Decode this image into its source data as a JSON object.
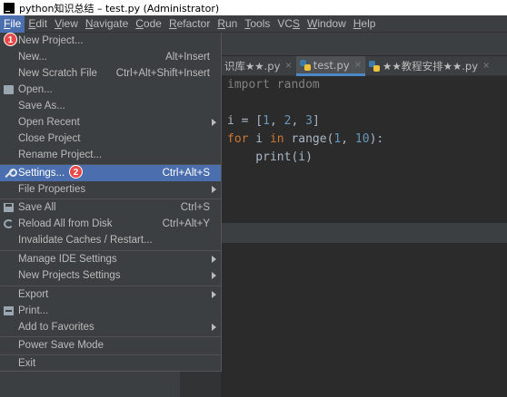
{
  "window": {
    "title": "python知识总结 – test.py (Administrator)"
  },
  "menubar": [
    {
      "label": "File",
      "mnemonic": "F",
      "rest": "ile"
    },
    {
      "label": "Edit",
      "mnemonic": "E",
      "rest": "dit"
    },
    {
      "label": "View",
      "mnemonic": "V",
      "rest": "iew"
    },
    {
      "label": "Navigate",
      "mnemonic": "N",
      "rest": "avigate"
    },
    {
      "label": "Code",
      "mnemonic": "C",
      "rest": "ode"
    },
    {
      "label": "Refactor",
      "mnemonic": "R",
      "rest": "efactor"
    },
    {
      "label": "Run",
      "mnemonic": "R",
      "rest": "un"
    },
    {
      "label": "Tools",
      "mnemonic": "T",
      "rest": "ools"
    },
    {
      "label": "VCS",
      "mnemonic": "S",
      "rest": "VC"
    },
    {
      "label": "Window",
      "mnemonic": "W",
      "rest": "indow"
    },
    {
      "label": "Help",
      "mnemonic": "H",
      "rest": "elp"
    }
  ],
  "tabs": [
    {
      "label": "识库★★.py",
      "close": "×"
    },
    {
      "label": "test.py",
      "close": "×"
    },
    {
      "label": "★★教程安排★★.py",
      "close": "×"
    }
  ],
  "editor": {
    "line1": "import random",
    "line2_a": "i = [",
    "line2_n1": "1",
    "line2_c1": ", ",
    "line2_n2": "2",
    "line2_c2": ", ",
    "line2_n3": "3",
    "line2_end": "]",
    "line3_for": "for",
    "line3_a": " i ",
    "line3_in": "in",
    "line3_b": " range(",
    "line3_n1": "1",
    "line3_c": ", ",
    "line3_n2": "10",
    "line3_end": "):",
    "line4": "    print(i)"
  },
  "file_menu": {
    "new_project": "New Project...",
    "new": "New...",
    "new_shortcut": "Alt+Insert",
    "new_scratch": "New Scratch File",
    "new_scratch_shortcut": "Ctrl+Alt+Shift+Insert",
    "open": "Open...",
    "save_as": "Save As...",
    "open_recent": "Open Recent",
    "close_project": "Close Project",
    "rename_project": "Rename Project...",
    "settings": "Settings...",
    "settings_shortcut": "Ctrl+Alt+S",
    "file_properties": "File Properties",
    "save_all": "Save All",
    "save_all_shortcut": "Ctrl+S",
    "reload": "Reload All from Disk",
    "reload_shortcut": "Ctrl+Alt+Y",
    "invalidate": "Invalidate Caches / Restart...",
    "manage_ide": "Manage IDE Settings",
    "new_projects_settings": "New Projects Settings",
    "export": "Export",
    "print": "Print...",
    "add_favorites": "Add to Favorites",
    "power_save": "Power Save Mode",
    "exit": "Exit"
  },
  "badges": {
    "step1": "1",
    "step2": "2"
  },
  "colors": {
    "accent": "#4b6eaf",
    "badge": "#e84a4a",
    "keyword": "#cc7832",
    "number": "#6897bb"
  }
}
